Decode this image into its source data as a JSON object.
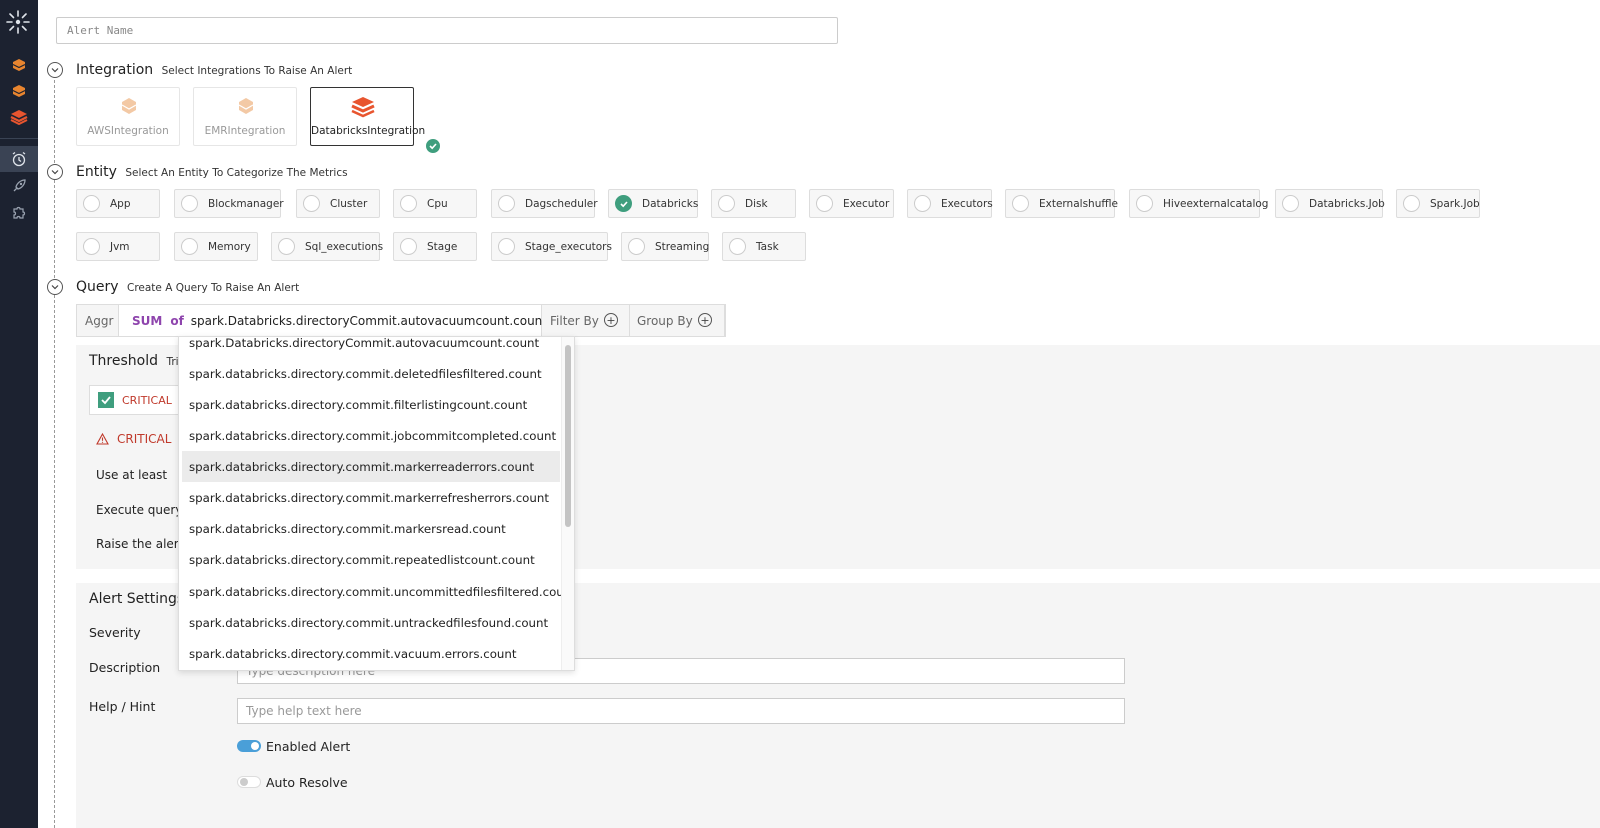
{
  "alert_name": {
    "placeholder": "Alert Name"
  },
  "integration": {
    "title": "Integration",
    "subtitle": "Select Integrations To Raise An Alert",
    "cards": [
      {
        "label": "AWSIntegration",
        "selected": false
      },
      {
        "label": "EMRIntegration",
        "selected": false
      },
      {
        "label": "DatabricksIntegration",
        "selected": true
      }
    ]
  },
  "entity": {
    "title": "Entity",
    "subtitle": "Select An Entity To Categorize The Metrics",
    "items": [
      "App",
      "Blockmanager",
      "Cluster",
      "Cpu",
      "Dagscheduler",
      "Databricks",
      "Disk",
      "Executor",
      "Executors",
      "Externalshuffle",
      "Hiveexternalcatalog",
      "Databricks.Job",
      "Spark.Job",
      "Jvm",
      "Memory",
      "Sql_executions",
      "Stage",
      "Stage_executors",
      "Streaming",
      "Task"
    ],
    "selected": "Databricks"
  },
  "query": {
    "title": "Query",
    "subtitle": "Create A Query To Raise An Alert",
    "aggr_label": "Aggr",
    "agg_func": "SUM",
    "of_label": "of",
    "metric": "spark.Databricks.directoryCommit.autovacuumcount.count",
    "filter_label": "Filter By",
    "group_label": "Group By"
  },
  "threshold": {
    "title": "Threshold",
    "subtitle_partial": "Trig",
    "critical_label": "CRITICAL",
    "critical_warning": "CRITICAL",
    "use_at_least": "Use at least",
    "execute_query": "Execute query",
    "raise_alert": "Raise the alert"
  },
  "alert_settings": {
    "title": "Alert Settings",
    "severity_label": "Severity",
    "description_label": "Description",
    "description_placeholder": "Type description here",
    "help_label": "Help / Hint",
    "help_placeholder": "Type help text here",
    "enabled_label": "Enabled Alert",
    "enabled_on": true,
    "auto_resolve_label": "Auto Resolve",
    "auto_resolve_on": false
  },
  "metric_dropdown": {
    "items": [
      "spark.Databricks.directoryCommit.autovacuumcount.count",
      "spark.databricks.directory.commit.deletedfilesfiltered.count",
      "spark.databricks.directory.commit.filterlistingcount.count",
      "spark.databricks.directory.commit.jobcommitcompleted.count",
      "spark.databricks.directory.commit.markerreaderrors.count",
      "spark.databricks.directory.commit.markerrefresherrors.count",
      "spark.databricks.directory.commit.markersread.count",
      "spark.databricks.directory.commit.repeatedlistcount.count",
      "spark.databricks.directory.commit.uncommittedfilesfiltered.count",
      "spark.databricks.directory.commit.untrackedfilesfound.count",
      "spark.databricks.directory.commit.vacuum.errors.count"
    ],
    "highlighted": "spark.databricks.directory.commit.markerreaderrors.count"
  },
  "colors": {
    "sidebar_bg": "#1c2230",
    "accent_orange": "#e8552f",
    "check_green": "#3f9e7e",
    "agg_purple": "#8e44ad",
    "critical_red": "#c0392b",
    "toggle_blue": "#4a9fd8"
  },
  "sidebar_icons": [
    "app-logo-icon",
    "databricks-icon",
    "databricks-icon",
    "databricks-icon",
    "alarm-clock-icon",
    "rocket-icon",
    "puzzle-icon"
  ]
}
